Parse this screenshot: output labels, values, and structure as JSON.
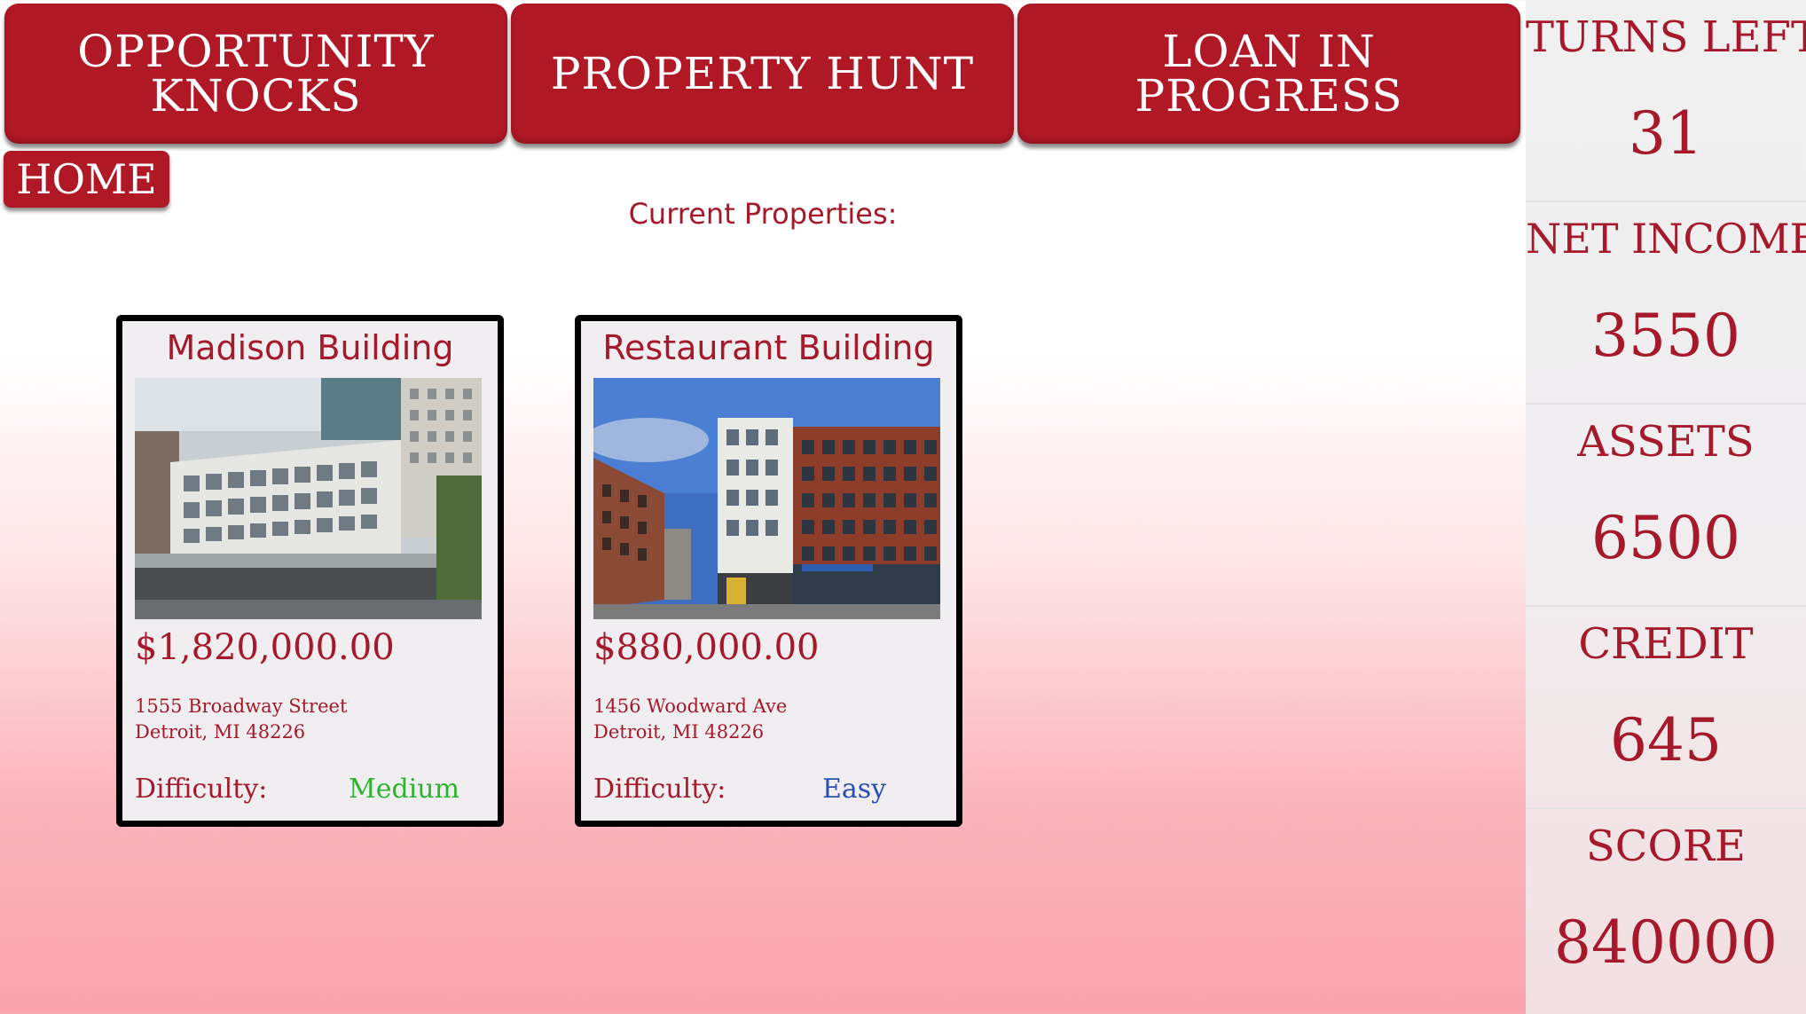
{
  "tabs": [
    {
      "label": "OPPORTUNITY\nKNOCKS"
    },
    {
      "label": "PROPERTY HUNT"
    },
    {
      "label": "LOAN IN\nPROGRESS"
    }
  ],
  "home_label": "HOME",
  "section_title": "Current Properties:",
  "properties": [
    {
      "name": "Madison Building",
      "price": "$1,820,000.00",
      "address_line1": "1555 Broadway Street",
      "address_line2": "Detroit, MI 48226",
      "difficulty_label": "Difficulty:",
      "difficulty": "Medium",
      "difficulty_color": "#2bb52c"
    },
    {
      "name": "Restaurant Building",
      "price": "$880,000.00",
      "address_line1": "1456 Woodward Ave",
      "address_line2": "Detroit, MI 48226",
      "difficulty_label": "Difficulty:",
      "difficulty": "Easy",
      "difficulty_color": "#2a4fb0"
    }
  ],
  "stats": [
    {
      "label": "TURNS LEFT",
      "value": "31"
    },
    {
      "label": "NET INCOME",
      "value": "3550"
    },
    {
      "label": "ASSETS",
      "value": "6500"
    },
    {
      "label": "CREDIT",
      "value": "645"
    },
    {
      "label": "SCORE",
      "value": "840000"
    }
  ],
  "colors": {
    "brand_red": "#b01826",
    "text_red": "#a5192a"
  }
}
